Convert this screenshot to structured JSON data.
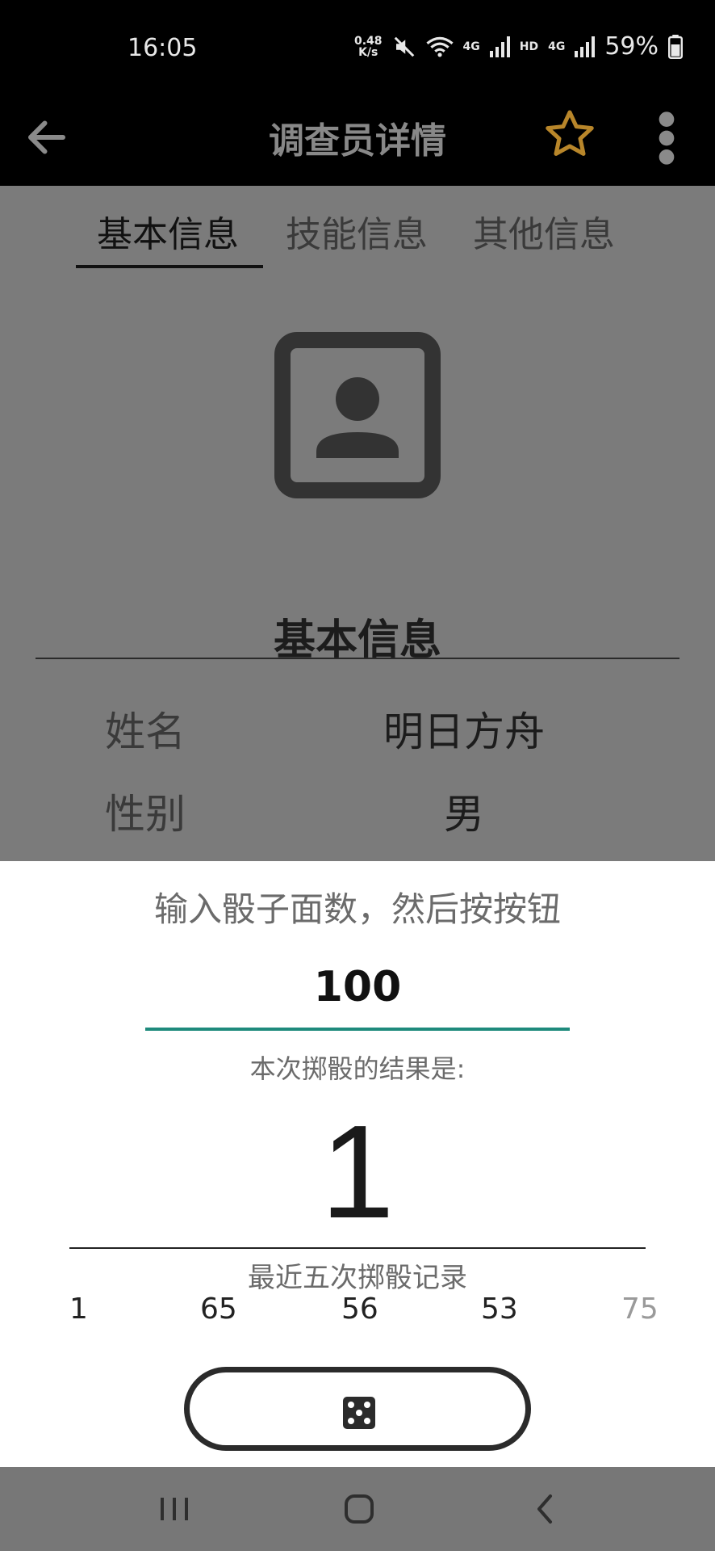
{
  "status_bar": {
    "time": "16:05",
    "net_speed_value": "0.48",
    "net_speed_unit": "K/s",
    "network_1": "4G",
    "hd": "HD",
    "network_2": "4G",
    "battery": "59%",
    "icons": [
      "mute-icon",
      "wifi-icon",
      "signal-icon",
      "battery-icon"
    ]
  },
  "app_bar": {
    "title": "调查员详情",
    "icons": [
      "back-arrow-icon",
      "star-icon",
      "more-vert-icon"
    ],
    "star_color": "#b8862a"
  },
  "tabs": [
    {
      "label": "基本信息",
      "active": true
    },
    {
      "label": "技能信息",
      "active": false
    },
    {
      "label": "其他信息",
      "active": false
    }
  ],
  "profile": {
    "avatar_icon": "portrait-placeholder-icon",
    "section_title": "基本信息",
    "fields": [
      {
        "label": "姓名",
        "value": "明日方舟"
      },
      {
        "label": "性别",
        "value": "男"
      }
    ]
  },
  "dice_sheet": {
    "prompt": "输入骰子面数，然后按按钮",
    "faces_value": "100",
    "result_label": "本次掷骰的结果是:",
    "result_value": "1",
    "history_label": "最近五次掷骰记录",
    "history": [
      "1",
      "65",
      "56",
      "53",
      "75"
    ],
    "roll_button_icon": "dice-icon",
    "accent_color": "#1e8a7c"
  },
  "nav_bar": {
    "icons": [
      "recent-apps-icon",
      "home-icon",
      "back-nav-icon"
    ]
  }
}
